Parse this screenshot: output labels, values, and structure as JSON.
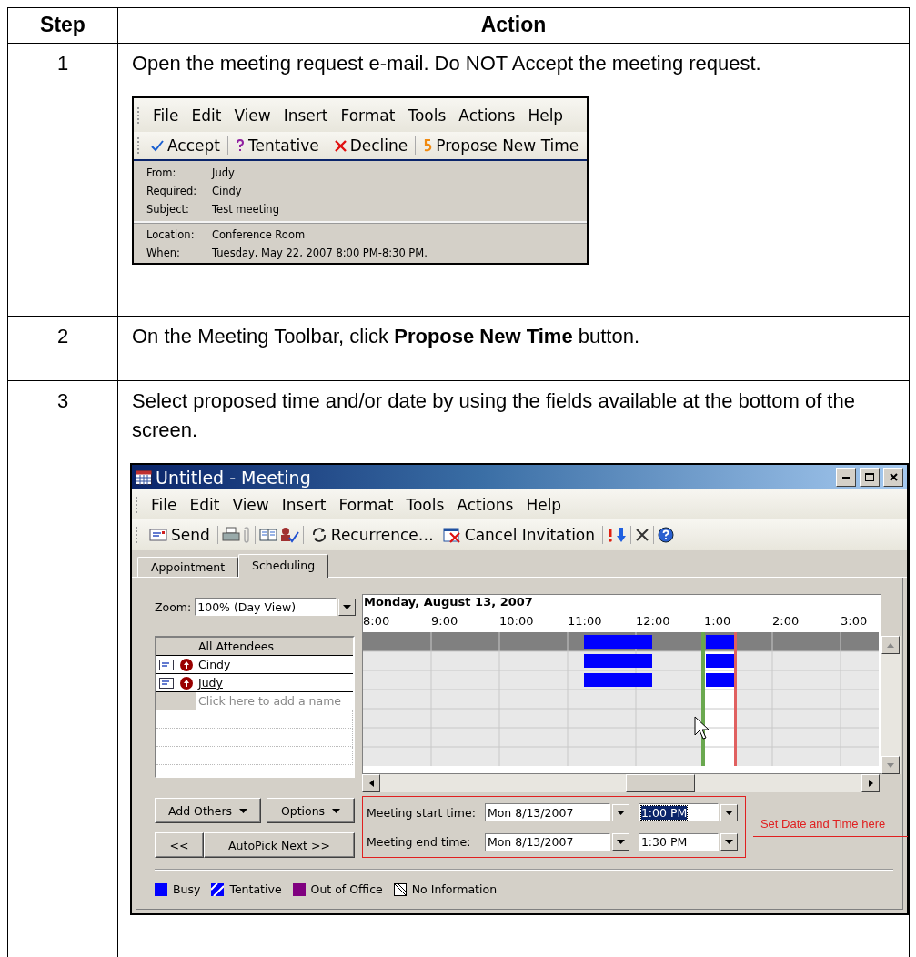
{
  "table": {
    "columns": [
      "Step",
      "Action"
    ],
    "rows": [
      {
        "step": "1",
        "text": "Open the meeting request e-mail. Do NOT Accept the meeting request.",
        "screenshot": {
          "kind": "message",
          "menu": [
            "File",
            "Edit",
            "View",
            "Insert",
            "Format",
            "Tools",
            "Actions",
            "Help"
          ],
          "toolbar": [
            {
              "kind": "accept",
              "label": "Accept"
            },
            {
              "kind": "tentative",
              "label": "Tentative"
            },
            {
              "kind": "decline",
              "label": "Decline"
            },
            {
              "kind": "propose",
              "label": "Propose New Time"
            }
          ],
          "fields": [
            {
              "label": "From:",
              "value": "Judy"
            },
            {
              "label": "Required:",
              "value": "Cindy"
            },
            {
              "label": "Subject:",
              "value": "Test meeting"
            }
          ],
          "details": [
            {
              "label": "Location:",
              "value": "Conference Room"
            },
            {
              "label": "When:",
              "value": "Tuesday, May 22, 2007 8:00 PM-8:30 PM."
            }
          ]
        }
      },
      {
        "step": "2",
        "text": "On the Meeting Toolbar, click **Propose New Time** button."
      },
      {
        "step": "3",
        "text": "Select proposed time and/or date by using the fields available at the bottom of the screen.",
        "screenshot": {
          "kind": "meeting",
          "title": "Untitled - Meeting",
          "menu": [
            "File",
            "Edit",
            "View",
            "Insert",
            "Format",
            "Tools",
            "Actions",
            "Help"
          ],
          "toolbar": [
            {
              "kind": "send",
              "label": "Send"
            },
            {
              "kind": "separator"
            },
            {
              "kind": "print"
            },
            {
              "kind": "attach"
            },
            {
              "kind": "separator"
            },
            {
              "kind": "address-book"
            },
            {
              "kind": "check-names"
            },
            {
              "kind": "separator"
            },
            {
              "kind": "recurrence",
              "label": "Recurrence…"
            },
            {
              "kind": "cancel",
              "label": "Cancel Invitation"
            },
            {
              "kind": "separator"
            },
            {
              "kind": "high"
            },
            {
              "kind": "low"
            },
            {
              "kind": "separator"
            },
            {
              "kind": "delete"
            },
            {
              "kind": "separator"
            },
            {
              "kind": "help"
            }
          ],
          "tabs": [
            {
              "label": "Appointment",
              "selected": false
            },
            {
              "label": "Scheduling",
              "selected": true
            }
          ],
          "zoom": {
            "label": "Zoom:",
            "value": "100% (Day View)"
          },
          "schedule": {
            "date": "Monday, August 13, 2007",
            "times": [
              "8:00",
              "9:00",
              "10:00",
              "11:00",
              "12:00",
              "1:00",
              "2:00",
              "3:00"
            ],
            "attendees_header": "All Attendees",
            "attendees": [
              {
                "name": "Cindy"
              },
              {
                "name": "Judy"
              }
            ],
            "add_hint": "Click here to add a name"
          },
          "buttons": [
            {
              "kind": "menu",
              "label": "Add Others"
            },
            {
              "kind": "menu",
              "label": "Options"
            },
            {
              "kind": "plain",
              "label": "<<"
            },
            {
              "kind": "plain",
              "label": "AutoPick Next >>"
            }
          ],
          "time_fields": [
            {
              "label": "Meeting start time:",
              "date": "Mon 8/13/2007",
              "time": "1:00 PM",
              "selected": true
            },
            {
              "label": "Meeting end time:",
              "date": "Mon 8/13/2007",
              "time": "1:30 PM",
              "selected": false
            }
          ],
          "annotation": "Set Date and Time here",
          "legend": [
            {
              "kind": "busy",
              "label": "Busy"
            },
            {
              "kind": "tentative",
              "label": "Tentative"
            },
            {
              "kind": "out-of-office",
              "label": "Out of Office"
            },
            {
              "kind": "no-information",
              "label": "No Information"
            }
          ]
        }
      }
    ]
  }
}
